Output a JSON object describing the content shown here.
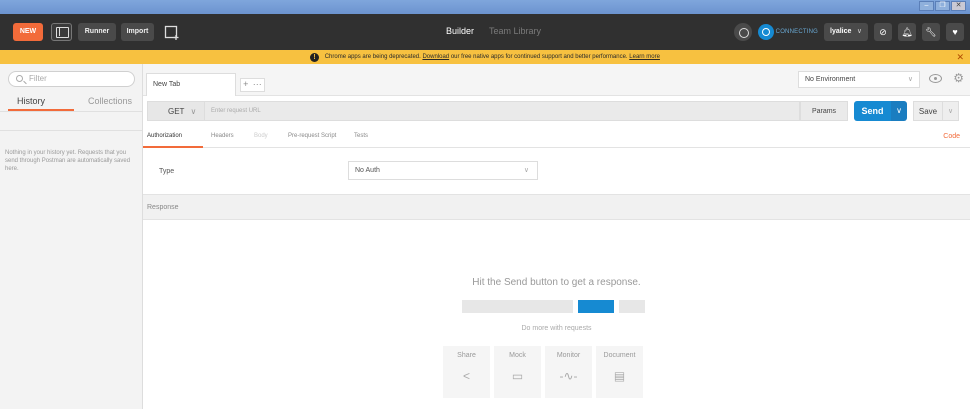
{
  "window": {
    "controls": [
      "–",
      "❐",
      "✕"
    ]
  },
  "toolbar": {
    "new_label": "NEW",
    "runner_label": "Runner",
    "import_label": "Import",
    "builder_label": "Builder",
    "team_library_label": "Team Library",
    "connecting_label": "CONNECTING",
    "user_label": "lyalice",
    "user_caret": "∨"
  },
  "banner": {
    "text_before": "Chrome apps are being deprecated.",
    "link_download": "Download",
    "text_middle": "our free native apps for continued support and better performance.",
    "link_learn": "Learn more",
    "close": "✕"
  },
  "sidebar": {
    "filter_placeholder": "Filter",
    "tabs": {
      "history": "History",
      "collections": "Collections"
    },
    "empty_text": "Nothing in your history yet. Requests that you send through Postman are automatically saved here."
  },
  "tabs": {
    "active_tab": "New Tab",
    "add": "+",
    "more": "···",
    "environment": "No Environment",
    "env_caret": "∨"
  },
  "request": {
    "method": "GET",
    "method_caret": "∨",
    "url_placeholder": "Enter request URL",
    "params_label": "Params",
    "send_label": "Send",
    "send_caret": "∨",
    "save_label": "Save",
    "save_caret": "∨"
  },
  "subtabs": {
    "authorization": "Authorization",
    "headers": "Headers",
    "body": "Body",
    "pre_request": "Pre-request Script",
    "tests": "Tests",
    "code": "Code"
  },
  "auth": {
    "type_label": "Type",
    "type_value": "No Auth",
    "type_caret": "∨"
  },
  "response": {
    "label": "Response",
    "empty_title": "Hit the Send button to get a response.",
    "more_title": "Do more with requests",
    "cards": [
      {
        "label": "Share",
        "icon": "share-icon",
        "glyph": "<"
      },
      {
        "label": "Mock",
        "icon": "mock-icon",
        "glyph": "▭"
      },
      {
        "label": "Monitor",
        "icon": "monitor-icon",
        "glyph": "-∿-"
      },
      {
        "label": "Document",
        "icon": "document-icon",
        "glyph": "▤"
      }
    ]
  },
  "colors": {
    "accent_orange": "#f26b3a",
    "send_blue": "#168ad2",
    "toolbar_bg": "#303030",
    "banner_yellow": "#f7c140"
  }
}
